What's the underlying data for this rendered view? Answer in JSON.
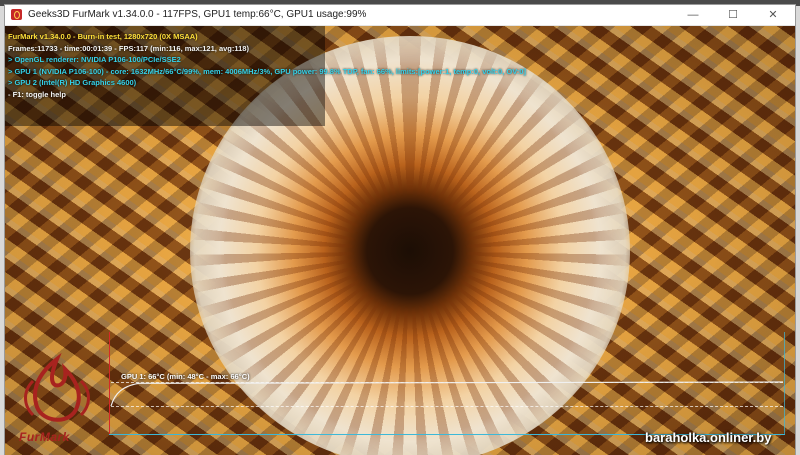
{
  "window": {
    "title": "Geeks3D FurMark v1.34.0.0 - 117FPS, GPU1 temp:66°C, GPU1 usage:99%",
    "minimize_glyph": "—",
    "maximize_glyph": "☐",
    "close_glyph": "✕"
  },
  "hud": {
    "line_title": "FurMark v1.34.0.0 - Burn-in test, 1280x720 (0X MSAA)",
    "line_frames": "Frames:11733 - time:00:01:39 - FPS:117 (min:116, max:121, avg:118)",
    "line_renderer": "> OpenGL renderer: NVIDIA P106-100/PCIe/SSE2",
    "line_gpu1": "> GPU 1 (NVIDIA P106-100) - core: 1632MHz/66°C/99%, mem: 4006MHz/3%, GPU power: 99.8% TDP, fan: 66%, limits:[power:1, temp:0, volt:0, OV:0]",
    "line_gpu2": "> GPU 2 (Intel(R) HD Graphics 4600)",
    "line_help": "- F1: toggle help"
  },
  "graph": {
    "label": "GPU 1: 66°C (min: 48°C - max: 66°C)",
    "axis_color": "#3cb8d8",
    "curve_color": "#f0f0f0",
    "temp_min": 48,
    "temp_max": 66,
    "temp_current": 66
  },
  "logo": {
    "text": "FurMark",
    "icon": "furmark-flame-logo-icon",
    "color": "#a8231f"
  },
  "watermark": {
    "text": "baraholka.onliner.by"
  }
}
